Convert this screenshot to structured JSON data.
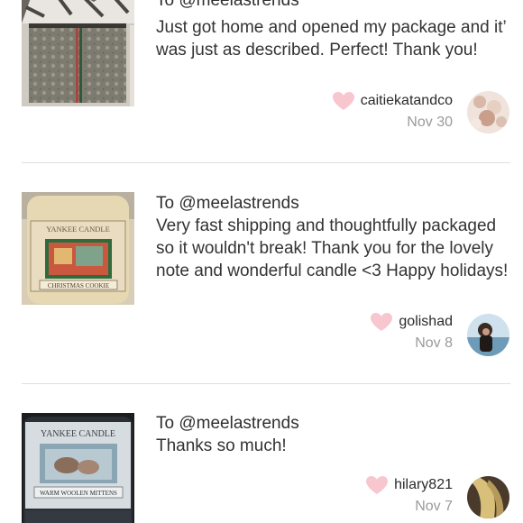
{
  "reviews": [
    {
      "to": "To @meelastrends",
      "text": "Just got home and opened my package and it’ was just as described. Perfect! Thank you!",
      "username": "caitiekatandco",
      "date": "Nov 30"
    },
    {
      "to": "To @meelastrends",
      "text": "Very fast shipping and thoughtfully packaged so it wouldn't break! Thank you for the lovely note and wonderful candle <3 Happy holidays!",
      "username": "golishad",
      "date": "Nov 8",
      "image_label_brand": "YANKEE CANDLE",
      "image_label_scent": "CHRISTMAS COOKIE"
    },
    {
      "to": "To @meelastrends",
      "text": "Thanks so much!",
      "username": "hilary821",
      "date": "Nov 7",
      "image_label_brand": "YANKEE CANDLE",
      "image_label_scent": "WARM WOOLEN MITTENS"
    }
  ],
  "icons": {
    "like": "heart-icon"
  },
  "colors": {
    "heart": "#f7c6cf",
    "date": "#9a9a9a",
    "divider": "#dedede"
  }
}
